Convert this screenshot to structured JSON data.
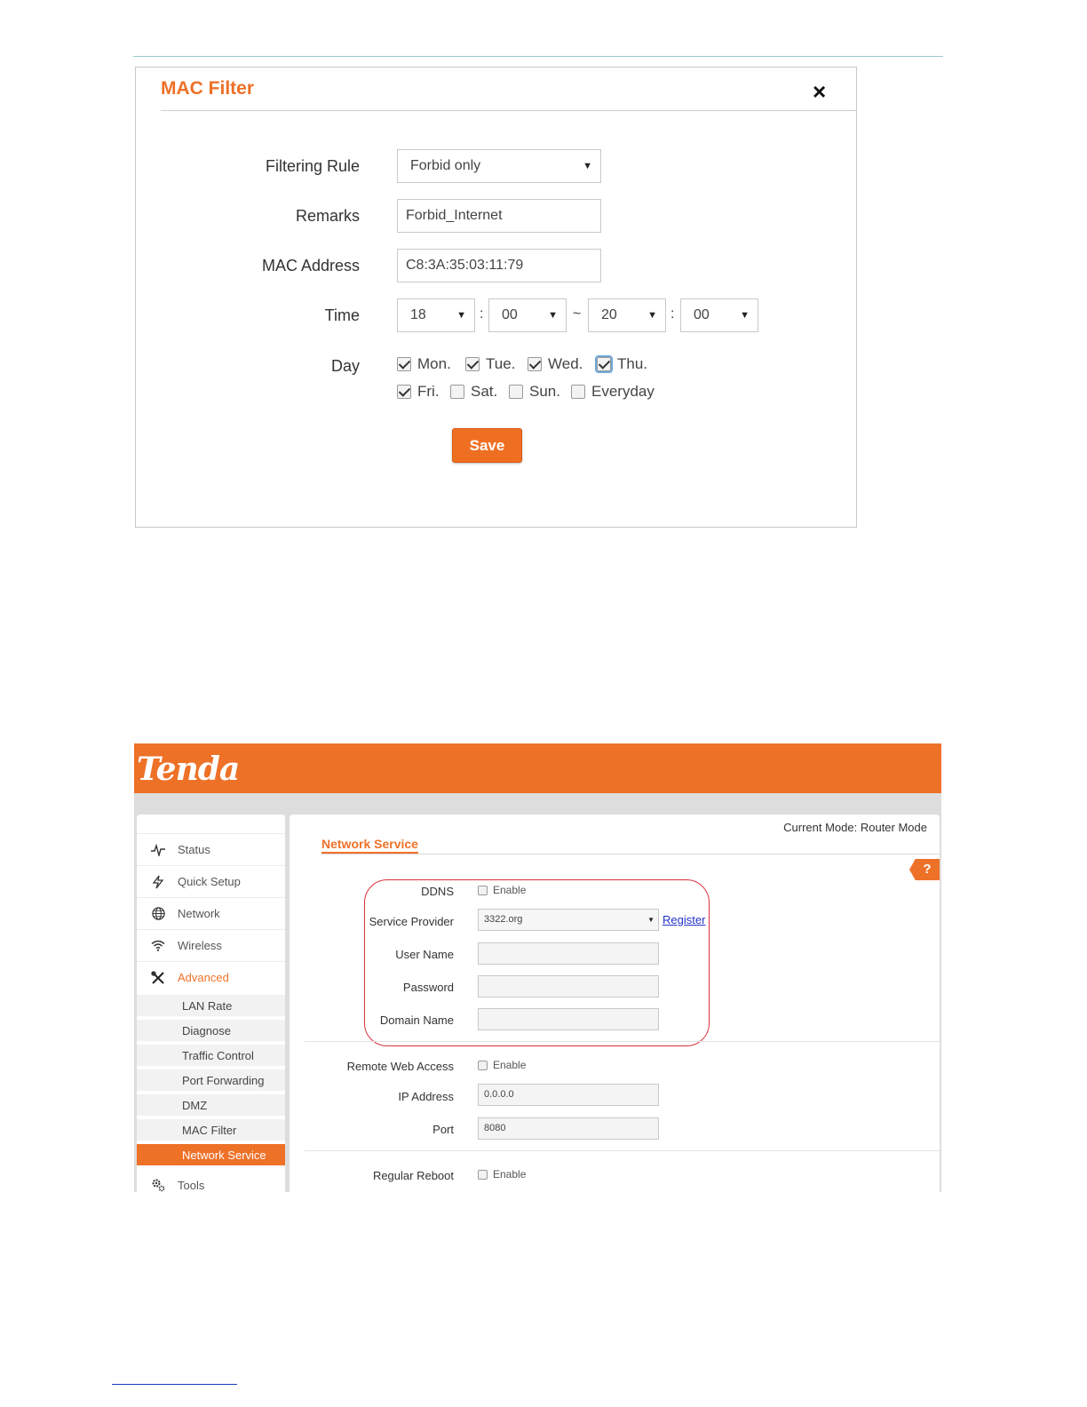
{
  "mac_filter_dialog": {
    "title": "MAC Filter",
    "close_icon": "×",
    "filtering_rule": {
      "label": "Filtering Rule",
      "value": "Forbid only"
    },
    "remarks": {
      "label": "Remarks",
      "value": "Forbid_Internet"
    },
    "mac_address": {
      "label": "MAC Address",
      "value": "C8:3A:35:03:11:79"
    },
    "time": {
      "label": "Time",
      "start_hour": "18",
      "start_minute": "00",
      "end_hour": "20",
      "end_minute": "00",
      "colon": ":",
      "tilde": "~"
    },
    "day": {
      "label": "Day",
      "items": [
        {
          "label": "Mon.",
          "checked": true
        },
        {
          "label": "Tue.",
          "checked": true
        },
        {
          "label": "Wed.",
          "checked": true
        },
        {
          "label": "Thu.",
          "checked": true
        },
        {
          "label": "Fri.",
          "checked": true
        },
        {
          "label": "Sat.",
          "checked": false
        },
        {
          "label": "Sun.",
          "checked": false
        },
        {
          "label": "Everyday",
          "checked": false
        }
      ]
    },
    "save_label": "Save"
  },
  "router": {
    "logo": "Tenda",
    "current_mode": "Current Mode: Router Mode",
    "page_title": "Network Service",
    "help_label": "?",
    "accent_color": "#ee7128",
    "sidebar": {
      "items": [
        {
          "label": "Status",
          "icon": "pulse-icon"
        },
        {
          "label": "Quick Setup",
          "icon": "star-icon"
        },
        {
          "label": "Network",
          "icon": "globe-icon"
        },
        {
          "label": "Wireless",
          "icon": "wifi-icon"
        },
        {
          "label": "Advanced",
          "icon": "tools-icon"
        }
      ],
      "sub_items": [
        "LAN Rate",
        "Diagnose",
        "Traffic Control",
        "Port Forwarding",
        "DMZ",
        "MAC Filter",
        "Network Service"
      ],
      "active_sub_item": "Network Service",
      "footer_item": {
        "label": "Tools",
        "icon": "gears-icon"
      }
    },
    "form": {
      "ddns": {
        "label": "DDNS",
        "enable_label": "Enable",
        "checked": false
      },
      "service_provider": {
        "label": "Service Provider",
        "value": "3322.org",
        "register_label": "Register"
      },
      "user_name": {
        "label": "User Name",
        "value": ""
      },
      "password": {
        "label": "Password",
        "value": ""
      },
      "domain_name": {
        "label": "Domain Name",
        "value": ""
      },
      "remote_web_access": {
        "label": "Remote Web Access",
        "enable_label": "Enable",
        "checked": false
      },
      "ip_address": {
        "label": "IP Address",
        "value": "0.0.0.0"
      },
      "port": {
        "label": "Port",
        "value": "8080"
      },
      "regular_reboot": {
        "label": "Regular Reboot",
        "enable_label": "Enable",
        "checked": false
      }
    }
  }
}
